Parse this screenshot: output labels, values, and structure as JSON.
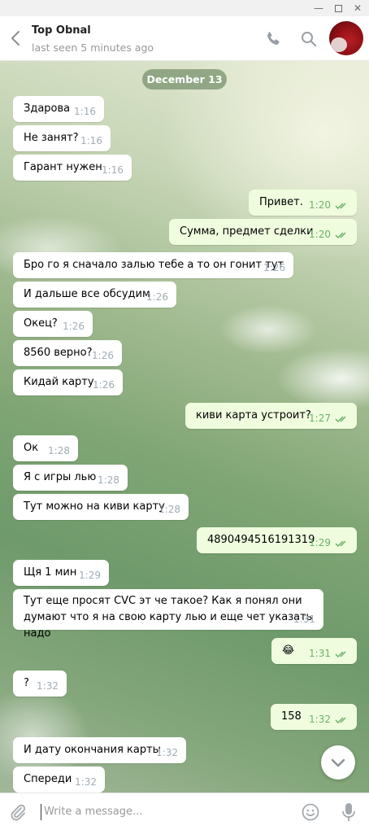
{
  "window": {
    "minimize_glyph": "—",
    "close_glyph": "✕"
  },
  "header": {
    "name": "Top Obnal",
    "status": "last seen 5 minutes ago",
    "icons": [
      "back-arrow-icon",
      "phone-icon",
      "search-icon",
      "avatar"
    ]
  },
  "chat": {
    "date_label": "December 13",
    "messages": [
      {
        "text": "Здарова",
        "time": "1:16",
        "outgoing": false
      },
      {
        "text": "Не занят?",
        "time": "1:16",
        "outgoing": false
      },
      {
        "text": "Гарант нужен",
        "time": "1:16",
        "outgoing": false
      },
      {
        "text": "Привет.",
        "time": "1:20",
        "outgoing": true
      },
      {
        "text": "Сумма, предмет сделки",
        "time": "1:20",
        "outgoing": true
      },
      {
        "text": "Бро го я сначало залью тебе а то он гонит тут",
        "time": "1:26",
        "outgoing": false
      },
      {
        "text": "И дальше все обсудим",
        "time": "1:26",
        "outgoing": false
      },
      {
        "text": "Окец?",
        "time": "1:26",
        "outgoing": false
      },
      {
        "text": "8560 верно?",
        "time": "1:26",
        "outgoing": false
      },
      {
        "text": "Кидай карту",
        "time": "1:26",
        "outgoing": false
      },
      {
        "text": "киви карта устроит?",
        "time": "1:27",
        "outgoing": true
      },
      {
        "text": "Ок",
        "time": "1:28",
        "outgoing": false
      },
      {
        "text": "Я с игры лью",
        "time": "1:28",
        "outgoing": false
      },
      {
        "text": "Тут можно на киви карту",
        "time": "1:28",
        "outgoing": false
      },
      {
        "text": "4890494516191319",
        "time": "1:29",
        "outgoing": true
      },
      {
        "text": "Щя 1 мин",
        "time": "1:29",
        "outgoing": false
      },
      {
        "text": "Тут еще просят CVC  эт че такое? Как я понял они думают что я на свою карту лью и еще чет указать надо",
        "time": "1:31",
        "outgoing": false
      },
      {
        "text": "😂",
        "time": "1:31",
        "outgoing": true
      },
      {
        "text": "?",
        "time": "1:32",
        "outgoing": false
      },
      {
        "text": "158",
        "time": "1:32",
        "outgoing": true
      },
      {
        "text": "И дату окончания карты",
        "time": "1:32",
        "outgoing": false
      },
      {
        "text": "Спереди",
        "time": "1:32",
        "outgoing": false
      }
    ]
  },
  "composer": {
    "placeholder": "Write a message...",
    "icons": [
      "attach-icon",
      "emoji-icon",
      "microphone-icon"
    ]
  },
  "colors": {
    "incoming_bubble": "#ffffff",
    "outgoing_bubble": "#effdde",
    "outgoing_time": "#6cb26b",
    "incoming_time": "#a0acb6",
    "date_pill": "#7f9a72"
  }
}
